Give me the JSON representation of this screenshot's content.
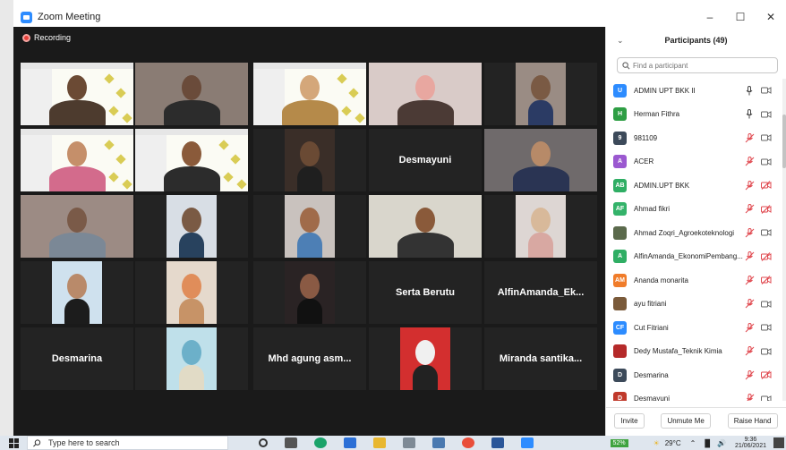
{
  "window": {
    "title": "Zoom Meeting",
    "controls": [
      "–",
      "☐",
      "✕"
    ]
  },
  "recording": {
    "label": "Recording"
  },
  "tiles": [
    {
      "name": "",
      "kind": "slide-man",
      "selected": false
    },
    {
      "name": "",
      "kind": "room-man",
      "selected": false
    },
    {
      "name": "",
      "kind": "slide-woman",
      "selected": true
    },
    {
      "name": "",
      "kind": "woman-pink",
      "selected": false
    },
    {
      "name": "",
      "kind": "man-small",
      "selected": false
    },
    {
      "name": "",
      "kind": "slide-woman2",
      "selected": false
    },
    {
      "name": "",
      "kind": "slide-man2",
      "selected": false
    },
    {
      "name": "",
      "kind": "man-dark",
      "selected": false
    },
    {
      "name": "Desmayuni",
      "kind": "name",
      "selected": false
    },
    {
      "name": "",
      "kind": "woman-navy",
      "selected": false
    },
    {
      "name": "",
      "kind": "man-blur",
      "selected": false
    },
    {
      "name": "",
      "kind": "man-small2",
      "selected": false
    },
    {
      "name": "",
      "kind": "man-blue",
      "selected": false
    },
    {
      "name": "",
      "kind": "slide-smile",
      "selected": false
    },
    {
      "name": "",
      "kind": "woman-beige",
      "selected": false
    },
    {
      "name": "",
      "kind": "woman-black",
      "selected": false
    },
    {
      "name": "",
      "kind": "woman-orange",
      "selected": false
    },
    {
      "name": "",
      "kind": "woman-dark",
      "selected": false
    },
    {
      "name": "Serta Berutu",
      "kind": "name",
      "selected": false
    },
    {
      "name": "AlfinAmanda_Ek...",
      "kind": "name",
      "selected": false
    },
    {
      "name": "Desmarina",
      "kind": "name",
      "selected": false
    },
    {
      "name": "",
      "kind": "beach",
      "selected": false
    },
    {
      "name": "Mhd agung asm...",
      "kind": "name",
      "selected": false
    },
    {
      "name": "",
      "kind": "portrait-red",
      "selected": false
    },
    {
      "name": "Miranda santika...",
      "kind": "name",
      "selected": false
    }
  ],
  "participants": {
    "title": "Participants (49)",
    "search_placeholder": "Find a participant",
    "items": [
      {
        "initials": "U",
        "color": "#2d8cff",
        "name": "ADMIN UPT BKK II",
        "mic": "on",
        "cam": "off"
      },
      {
        "initials": "H",
        "color": "#2e9e44",
        "name": "Herman Fithra",
        "mic": "on",
        "cam": "off"
      },
      {
        "initials": "9",
        "color": "#3c4a5a",
        "name": "981109",
        "mic": "muted",
        "cam": "off"
      },
      {
        "initials": "A",
        "color": "#9b59d0",
        "name": "ACER",
        "mic": "muted",
        "cam": "off"
      },
      {
        "initials": "AB",
        "color": "#2fae64",
        "name": "ADMIN.UPT BKK",
        "mic": "muted",
        "cam": "blocked"
      },
      {
        "initials": "AF",
        "color": "#34b36a",
        "name": "Ahmad fikri",
        "mic": "muted",
        "cam": "blocked"
      },
      {
        "initials": "",
        "color": "#5b6a4c",
        "name": "Ahmad Zoqri_Agroekoteknologi",
        "mic": "muted",
        "cam": "off"
      },
      {
        "initials": "A",
        "color": "#2fae64",
        "name": "AlfinAmanda_EkonomiPembang...",
        "mic": "muted",
        "cam": "blocked"
      },
      {
        "initials": "AM",
        "color": "#f07c2a",
        "name": "Ananda monarita",
        "mic": "muted",
        "cam": "blocked"
      },
      {
        "initials": "",
        "color": "#7a5a3a",
        "name": "ayu fitriani",
        "mic": "muted",
        "cam": "off"
      },
      {
        "initials": "CF",
        "color": "#2d8cff",
        "name": "Cut Fitriani",
        "mic": "muted",
        "cam": "off"
      },
      {
        "initials": "",
        "color": "#b52a2a",
        "name": "Dedy Mustafa_Teknik Kimia",
        "mic": "muted",
        "cam": "off"
      },
      {
        "initials": "D",
        "color": "#3c4a5a",
        "name": "Desmarina",
        "mic": "muted",
        "cam": "blocked"
      },
      {
        "initials": "D",
        "color": "#c0392b",
        "name": "Desmayuni",
        "mic": "muted",
        "cam": "off"
      }
    ],
    "buttons": {
      "invite": "Invite",
      "unmute": "Unmute Me",
      "raise": "Raise Hand"
    }
  },
  "taskbar": {
    "search_placeholder": "Type here to search",
    "battery": "52%",
    "temperature": "29°C",
    "time": "9:36",
    "date": "21/06/2021"
  },
  "colors": {
    "selected_border": "#a8d95a",
    "zoom_blue": "#2d8cff",
    "muted_red": "#e0484f"
  }
}
